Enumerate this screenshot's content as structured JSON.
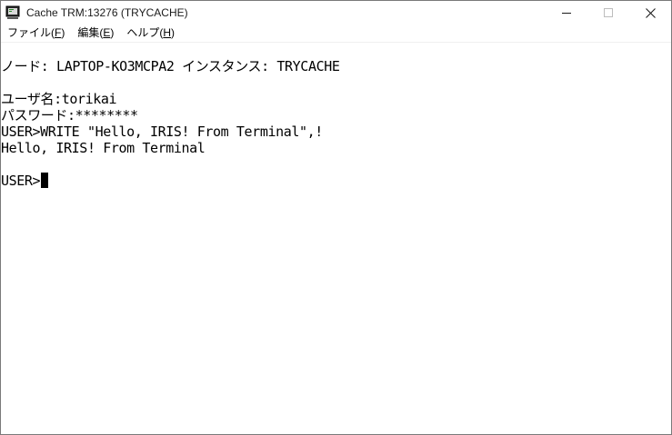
{
  "window": {
    "title": "Cache TRM:13276 (TRYCACHE)",
    "icon": "terminal-app-icon"
  },
  "controls": {
    "minimize_icon": "minimize-icon",
    "maximize_icon": "maximize-icon",
    "close_icon": "close-icon"
  },
  "menu": {
    "file": {
      "label": "ファイル(",
      "key": "F",
      "tail": ")"
    },
    "edit": {
      "label": "編集(",
      "key": "E",
      "tail": ")"
    },
    "help": {
      "label": "ヘルプ(",
      "key": "H",
      "tail": ")"
    }
  },
  "terminal": {
    "node_line": "ノード: LAPTOP-KO3MCPA2 インスタンス: TRYCACHE",
    "user_line": "ユーザ名:torikai",
    "password_line": "パスワード:********",
    "command_line": "USER>WRITE \"Hello, IRIS! From Terminal\",!",
    "output_line": "Hello, IRIS! From Terminal",
    "prompt": "USER>"
  },
  "colors": {
    "background": "#ffffff",
    "text": "#000000",
    "cursor": "#000000"
  }
}
